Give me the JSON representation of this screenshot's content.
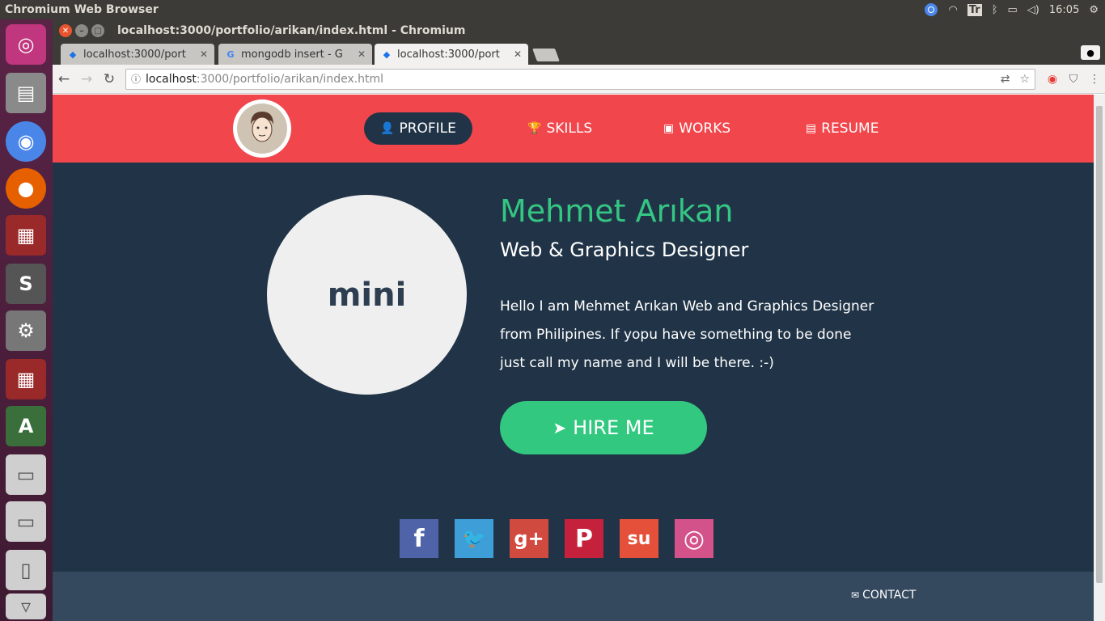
{
  "os": {
    "app_title": "Chromium Web Browser",
    "clock": "16:05",
    "tray_icons": [
      "chromium-icon",
      "wifi-icon",
      "keyboard-icon",
      "bluetooth-icon",
      "battery-icon",
      "volume-icon",
      "gear-icon"
    ],
    "keyboard_label": "Tr"
  },
  "launcher": {
    "items": [
      "ubuntu-logo-icon",
      "files-icon",
      "chromium-icon",
      "firefox-icon",
      "terminal-icon",
      "sublime-text-icon",
      "system-settings-icon",
      "terminal-icon",
      "software-updater-icon",
      "drive-icon",
      "drive-icon",
      "usb-drive-icon",
      "trash-icon"
    ]
  },
  "window": {
    "title": "localhost:3000/portfolio/arikan/index.html - Chromium"
  },
  "tabs": [
    {
      "label": "localhost:3000/port",
      "icon": "devtools-icon"
    },
    {
      "label": "mongodb insert - G",
      "icon": "google-icon"
    },
    {
      "label": "localhost:3000/port",
      "icon": "devtools-icon",
      "active": true
    }
  ],
  "omnibox": {
    "host": "localhost",
    "rest": ":3000/portfolio/arikan/index.html"
  },
  "site": {
    "nav": {
      "profile": "PROFILE",
      "skills": "SKILLS",
      "works": "WORKS",
      "resume": "RESUME"
    },
    "avatar_text": "mini",
    "name": "Mehmet Arıkan",
    "role": "Web & Graphics Designer",
    "bio": "Hello I am Mehmet Arıkan Web and Graphics Designer from Philipines. If yopu have something to be done just call my name and I will be there. :-)",
    "hire": "HIRE ME",
    "social": [
      {
        "name": "facebook",
        "glyph": "f",
        "color": "#4e63a8"
      },
      {
        "name": "twitter",
        "glyph": "🐦",
        "color": "#3d9ed8"
      },
      {
        "name": "google-plus",
        "glyph": "g+",
        "color": "#d14a3f"
      },
      {
        "name": "pinterest",
        "glyph": "P",
        "color": "#c5213c"
      },
      {
        "name": "stumbleupon",
        "glyph": "su",
        "color": "#e4503a"
      },
      {
        "name": "dribbble",
        "glyph": "◎",
        "color": "#d4528a"
      }
    ],
    "contact": "CONTACT"
  },
  "colors": {
    "nav_bg": "#f1464b",
    "page_bg": "#213447",
    "accent_green": "#34c683",
    "footer_bg": "#34495e"
  }
}
